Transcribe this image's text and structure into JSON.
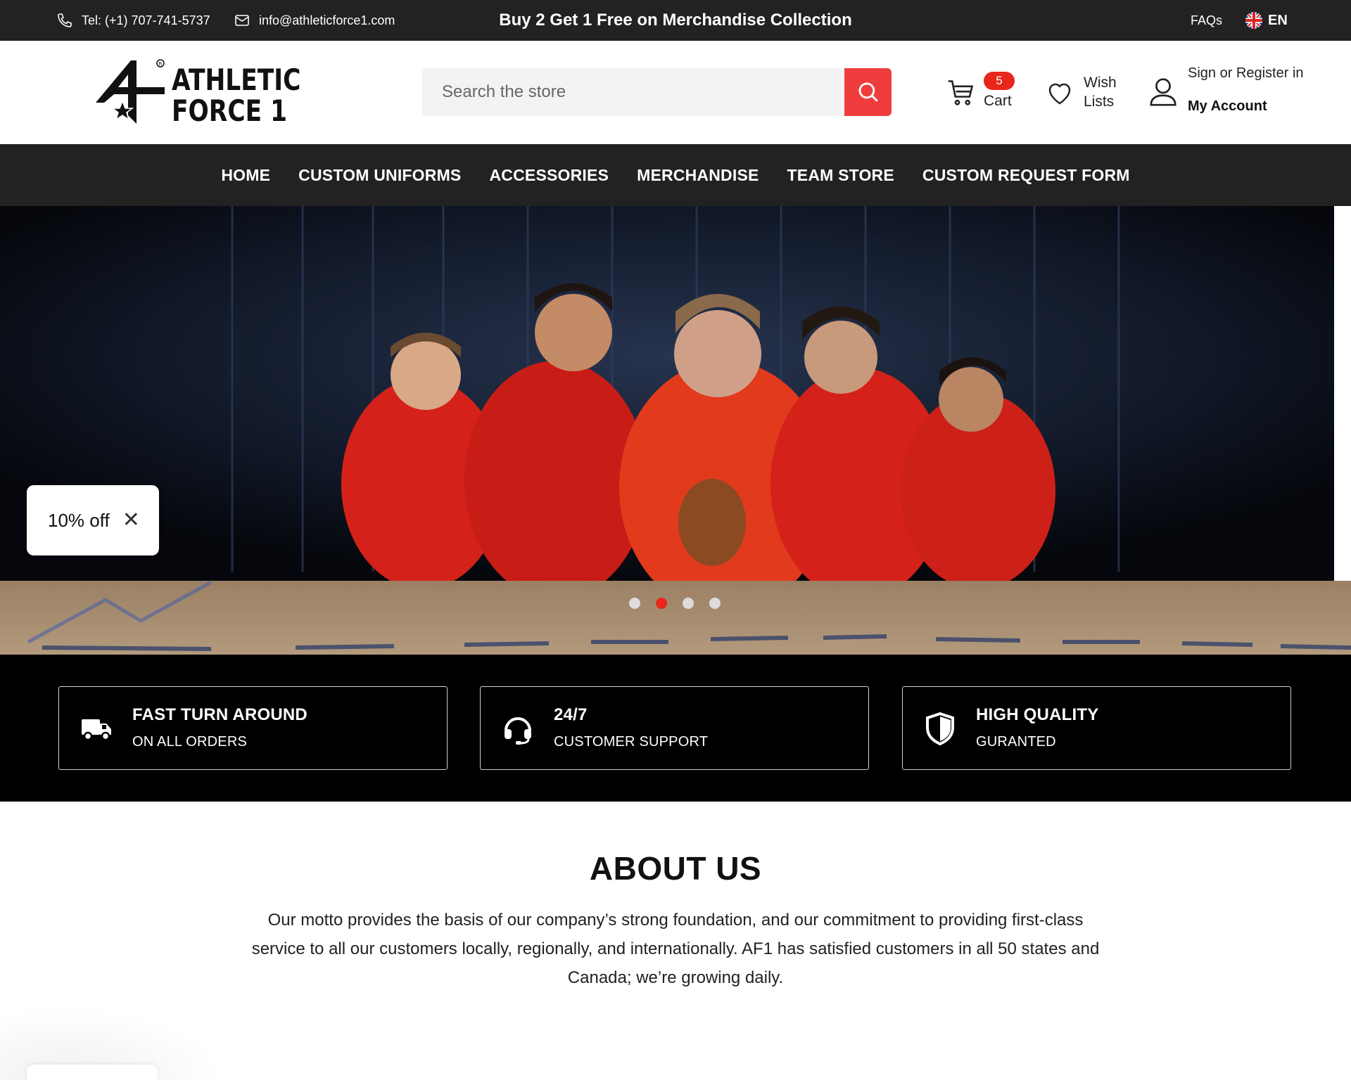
{
  "topbar": {
    "phone": "Tel: (+1) 707-741-5737",
    "email": "info@athleticforce1.com",
    "promo": "Buy 2 Get 1 Free on Merchandise Collection",
    "faqs": "FAQs",
    "language": "EN"
  },
  "header": {
    "logo_line1": "ATHLETIC",
    "logo_line2": "FORCE 1",
    "search_placeholder": "Search the store",
    "cart_count": "5",
    "cart_label": "Cart",
    "wish_label": "Wish Lists",
    "signin_label": "Sign or Register in",
    "account_label": "My Account"
  },
  "nav": {
    "items": [
      {
        "label": "HOME"
      },
      {
        "label": "CUSTOM UNIFORMS"
      },
      {
        "label": "ACCESSORIES"
      },
      {
        "label": "MERCHANDISE"
      },
      {
        "label": "TEAM STORE"
      },
      {
        "label": "CUSTOM REQUEST FORM"
      }
    ]
  },
  "hero": {
    "slides": 4,
    "active_slide": 2
  },
  "popup": {
    "text": "10% off"
  },
  "features": [
    {
      "title": "FAST TURN AROUND",
      "subtitle": "ON ALL ORDERS",
      "icon": "truck-icon"
    },
    {
      "title": "24/7",
      "subtitle": "CUSTOMER SUPPORT",
      "icon": "headset-icon"
    },
    {
      "title": "HIGH QUALITY",
      "subtitle": "GURANTED",
      "icon": "shield-icon"
    }
  ],
  "about": {
    "heading": "ABOUT US",
    "body": "Our motto provides the basis of our company’s strong foundation, and our commitment to providing first-class service to all our customers locally, regionally, and internationally. AF1 has satisfied customers in all 50 states and Canada; we’re growing daily."
  },
  "colors": {
    "accent": "#ef3d3d",
    "badge": "#e8261c",
    "dark": "#222222"
  }
}
